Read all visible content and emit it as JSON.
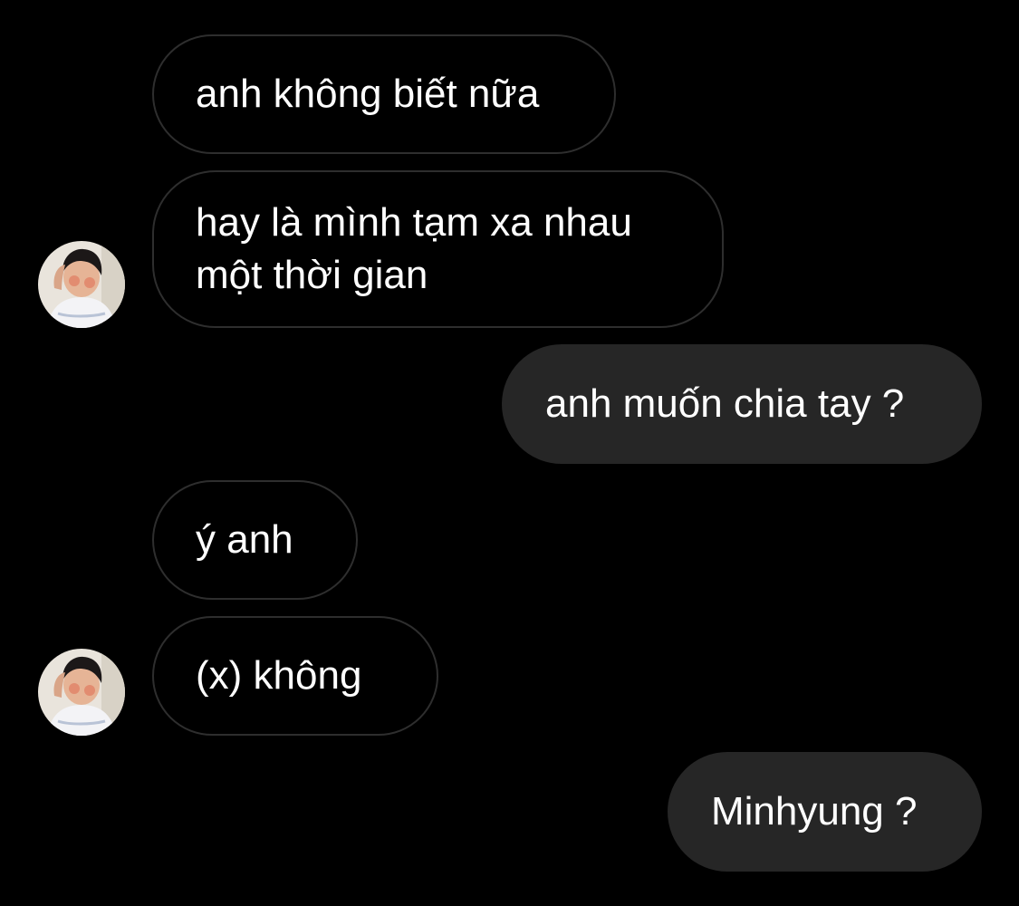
{
  "chat": {
    "messages": [
      {
        "sender": "them",
        "lines": [
          "anh không biết nữa"
        ]
      },
      {
        "sender": "them",
        "lines": [
          "hay là mình tạm xa nhau",
          "một thời gian"
        ],
        "avatar": "profile-photo-child"
      },
      {
        "sender": "me",
        "lines": [
          "anh muốn chia tay ?"
        ]
      },
      {
        "sender": "them",
        "lines": [
          "ý anh"
        ]
      },
      {
        "sender": "them",
        "lines": [
          "(x) không"
        ],
        "avatar": "profile-photo-child"
      },
      {
        "sender": "me",
        "lines": [
          "Minhyung ?"
        ]
      }
    ]
  },
  "colors": {
    "background": "#000000",
    "outgoing_bubble": "#262626",
    "incoming_border": "#2e2e2e",
    "text": "#ffffff"
  }
}
